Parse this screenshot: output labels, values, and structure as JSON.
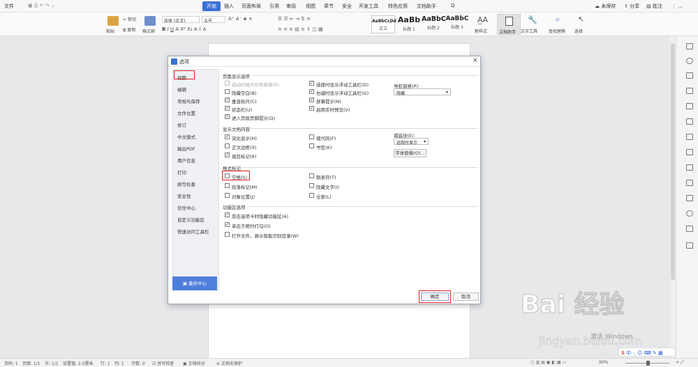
{
  "titlebar": {
    "menu": "文件",
    "tabs": [
      "开始",
      "插入",
      "页面布局",
      "引用",
      "审阅",
      "视图",
      "章节",
      "安全",
      "开发工具",
      "特色应用",
      "文档助手"
    ],
    "active_tab": "开始",
    "search": "Q",
    "right": [
      "未保存",
      "分享",
      "批注"
    ]
  },
  "ribbon": {
    "paste": "粘贴",
    "cut": "剪切",
    "copy": "复制",
    "format_painter": "格式刷",
    "font": "宋体 (正文)",
    "size": "五号",
    "styles": [
      {
        "preview": "AaBbCcDd",
        "name": "正文"
      },
      {
        "preview": "AaBb",
        "name": "标题 1"
      },
      {
        "preview": "AaBbC",
        "name": "标题 2"
      },
      {
        "preview": "AaBbC",
        "name": "标题 3"
      }
    ],
    "new_style": "新样式",
    "doc_assistant": "文档助手",
    "text_tools": "文字工具",
    "find_replace": "查找替换",
    "select": "选择"
  },
  "dialog": {
    "title": "选项",
    "nav": [
      "视图",
      "编辑",
      "常规与保存",
      "文件位置",
      "修订",
      "中文版式",
      "输出PDF",
      "用户信息",
      "打印",
      "拼写检查",
      "安全性",
      "信任中心",
      "自定义功能区",
      "快速访问工具栏"
    ],
    "backup": "备份中心",
    "sections": {
      "page_display": {
        "title": "页面显示选项",
        "left": [
          {
            "label": "启动时展开任务窗格(R)",
            "checked": false,
            "disabled": true
          },
          {
            "label": "隐藏空白(B)",
            "checked": false
          },
          {
            "label": "垂直标尺(C)",
            "checked": true
          },
          {
            "label": "状态栏(U)",
            "checked": true
          },
          {
            "label": "进入页眉页脚提示(Q)",
            "checked": true
          }
        ],
        "right": [
          {
            "label": "选择时显示浮动工具栏(D)",
            "checked": true
          },
          {
            "label": "右键时显示浮动工具栏(G)",
            "checked": true
          },
          {
            "label": "屏幕提示(N)",
            "checked": true
          },
          {
            "label": "启用实时预览(V)",
            "checked": true
          }
        ],
        "nav_pane_label": "导航窗格(P):",
        "nav_pane_value": "隐藏"
      },
      "doc_content": {
        "title": "显示文档内容",
        "left": [
          {
            "label": "突出显示(H)",
            "checked": true
          },
          {
            "label": "正文边框(X)",
            "checked": false
          },
          {
            "label": "裁剪标记(R)",
            "checked": true
          }
        ],
        "right": [
          {
            "label": "域代码(F)",
            "checked": false
          },
          {
            "label": "书签(K)",
            "checked": false
          }
        ],
        "field_shading_label": "域底纹(E):",
        "field_shading_value": "选取时显示",
        "font_replace": "字体替换(O)..."
      },
      "format_marks": {
        "title": "格式标记",
        "left": [
          {
            "label": "空格(S)",
            "checked": false
          },
          {
            "label": "段落标记(M)",
            "checked": false
          },
          {
            "label": "对象位置(J)",
            "checked": false
          }
        ],
        "right": [
          {
            "label": "制表符(T)",
            "checked": false
          },
          {
            "label": "隐藏文字(I)",
            "checked": false
          },
          {
            "label": "全部(L)",
            "checked": false
          }
        ]
      },
      "ribbon_options": {
        "title": "功能区选项",
        "items": [
          {
            "label": "双击选项卡时隐藏功能区(A)",
            "checked": true
          },
          {
            "label": "单击方框时打勾(O)",
            "checked": true
          },
          {
            "label": "打开文件，展示智能识别目录(W)",
            "checked": false
          }
        ]
      }
    },
    "ok": "确定",
    "cancel": "取消"
  },
  "status": {
    "items": [
      "页码: 1",
      "页面: 1/1",
      "节: 1/1",
      "设置值: 2.5厘米",
      "行: 1",
      "列: 1",
      "字数: 0",
      "拼写检查",
      "文档校对",
      "文档未保护"
    ],
    "zoom": "90%"
  },
  "watermark": {
    "line1": "Bai 经验",
    "line2": "jingyan.baidu.com",
    "activate": "激活 Windows"
  }
}
